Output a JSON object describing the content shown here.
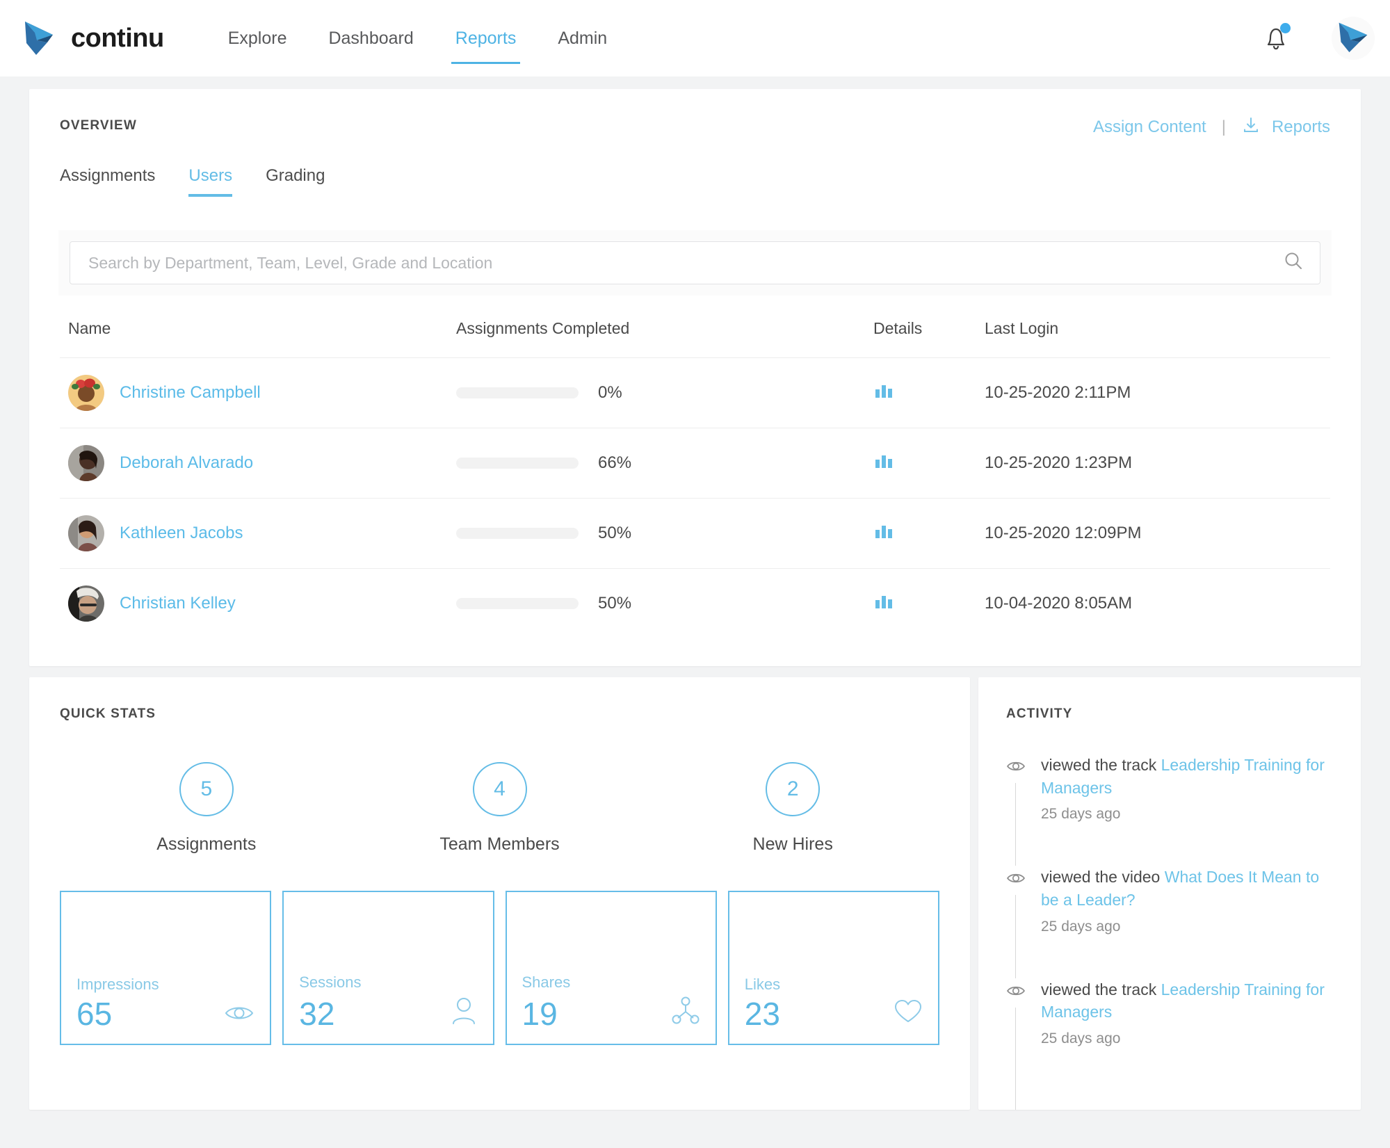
{
  "brand": {
    "name": "continu",
    "logo_icon": "continu-chevron-logo"
  },
  "nav": {
    "links": [
      {
        "label": "Explore",
        "active": false
      },
      {
        "label": "Dashboard",
        "active": false
      },
      {
        "label": "Reports",
        "active": true
      },
      {
        "label": "Admin",
        "active": false
      }
    ],
    "notifications_icon": "bell-icon",
    "has_unread": true,
    "avatar_icon": "user-avatar"
  },
  "overview": {
    "title": "OVERVIEW",
    "assign_content_label": "Assign Content",
    "separator": "|",
    "reports_label": "Reports",
    "download_icon": "download-icon",
    "tabs": [
      {
        "label": "Assignments",
        "active": false
      },
      {
        "label": "Users",
        "active": true
      },
      {
        "label": "Grading",
        "active": false
      }
    ],
    "search": {
      "placeholder": "Search by Department, Team, Level, Grade and Location",
      "value": "",
      "icon": "search-icon"
    },
    "table": {
      "headers": [
        "Name",
        "Assignments Completed",
        "Details",
        "Last Login"
      ],
      "rows": [
        {
          "name": "Christine Campbell",
          "progress": 0,
          "progress_label": "0%",
          "details_icon": "bar-chart-icon",
          "last_login": "10-25-2020 2:11PM",
          "avatar_bg": "#f2c97d",
          "avatar_tone": "#6e4526"
        },
        {
          "name": "Deborah Alvarado",
          "progress": 66,
          "progress_label": "66%",
          "details_icon": "bar-chart-icon",
          "last_login": "10-25-2020 1:23PM",
          "avatar_bg": "#6f6a66",
          "avatar_tone": "#3b2b22"
        },
        {
          "name": "Kathleen Jacobs",
          "progress": 50,
          "progress_label": "50%",
          "details_icon": "bar-chart-icon",
          "last_login": "10-25-2020 12:09PM",
          "avatar_bg": "#9b9a98",
          "avatar_tone": "#4b3a34"
        },
        {
          "name": "Christian Kelley",
          "progress": 50,
          "progress_label": "50%",
          "details_icon": "bar-chart-icon",
          "last_login": "10-04-2020 8:05AM",
          "avatar_bg": "#5d5c5a",
          "avatar_tone": "#23201e"
        }
      ]
    }
  },
  "quick_stats": {
    "title": "QUICK STATS",
    "circles": [
      {
        "value": "5",
        "label": "Assignments"
      },
      {
        "value": "4",
        "label": "Team Members"
      },
      {
        "value": "2",
        "label": "New Hires"
      }
    ],
    "boxes": [
      {
        "label": "Impressions",
        "value": "65",
        "icon": "eye-icon"
      },
      {
        "label": "Sessions",
        "value": "32",
        "icon": "person-icon"
      },
      {
        "label": "Shares",
        "value": "19",
        "icon": "share-nodes-icon"
      },
      {
        "label": "Likes",
        "value": "23",
        "icon": "heart-icon"
      }
    ]
  },
  "activity": {
    "title": "ACTIVITY",
    "items": [
      {
        "icon": "eye-icon",
        "prefix": "viewed the track ",
        "object": "Leadership Training for Managers",
        "time": "25 days ago"
      },
      {
        "icon": "eye-icon",
        "prefix": "viewed the video ",
        "object": "What Does It Mean to be a Leader?",
        "time": "25 days ago"
      },
      {
        "icon": "eye-icon",
        "prefix": "viewed the track ",
        "object": "Leadership Training for Managers",
        "time": "25 days ago"
      }
    ]
  },
  "colors": {
    "accent": "#4eb3e4",
    "link": "#5bbbe8",
    "text": "#4a4a4a",
    "page_bg": "#f2f3f4",
    "progress_fill": "#53b7ec"
  }
}
